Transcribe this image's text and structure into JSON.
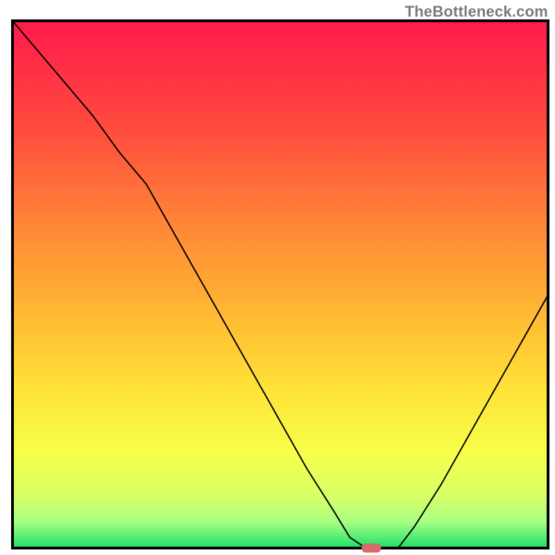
{
  "watermark": "TheBottleneck.com",
  "chart_data": {
    "type": "line",
    "title": "",
    "xlabel": "",
    "ylabel": "",
    "xlim": [
      0,
      100
    ],
    "ylim": [
      0,
      100
    ],
    "grid": false,
    "legend": false,
    "series": [
      {
        "name": "bottleneck-curve",
        "x": [
          0,
          5,
          10,
          15,
          20,
          25,
          30,
          35,
          40,
          45,
          50,
          55,
          60,
          63,
          66,
          69,
          72,
          75,
          80,
          85,
          90,
          95,
          100
        ],
        "values": [
          100,
          94,
          88,
          82,
          75,
          69,
          60,
          51,
          42,
          33,
          24,
          15,
          7,
          2,
          0,
          0,
          0,
          4,
          12,
          21,
          30,
          39,
          48
        ]
      }
    ],
    "marker": {
      "x": 67,
      "y": 0,
      "color": "#d46a6a"
    },
    "gradient_stops": [
      {
        "offset": 0.0,
        "color": "#ff1a4b"
      },
      {
        "offset": 0.2,
        "color": "#ff4a3f"
      },
      {
        "offset": 0.4,
        "color": "#ff8a36"
      },
      {
        "offset": 0.55,
        "color": "#ffb733"
      },
      {
        "offset": 0.7,
        "color": "#ffe338"
      },
      {
        "offset": 0.82,
        "color": "#f7ff4a"
      },
      {
        "offset": 0.9,
        "color": "#d8ff66"
      },
      {
        "offset": 0.95,
        "color": "#a8ff82"
      },
      {
        "offset": 1.0,
        "color": "#1fdf6a"
      }
    ],
    "border_color": "#000000",
    "line_color": "#000000",
    "line_width": 2
  }
}
